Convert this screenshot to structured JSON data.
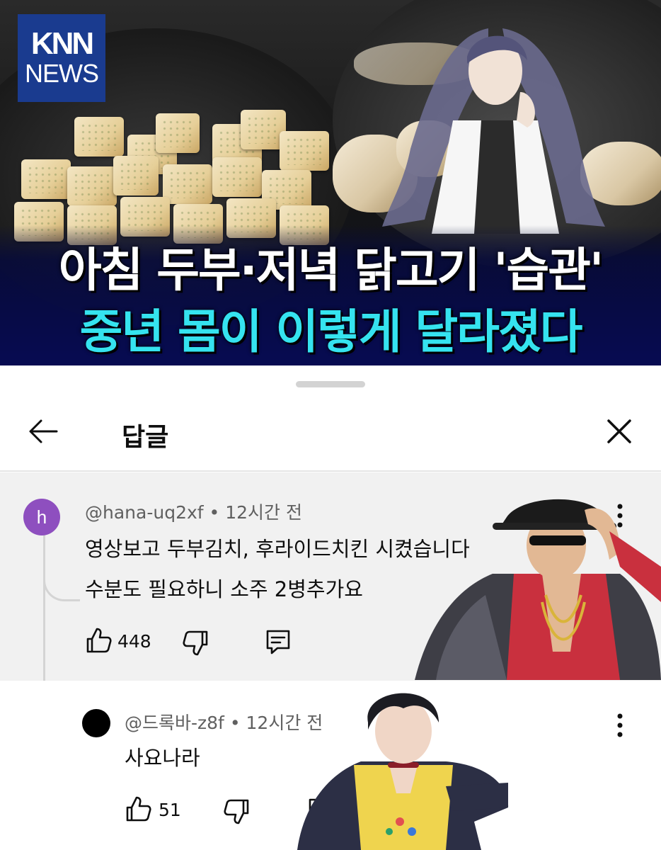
{
  "news": {
    "logo_top": "KNN",
    "logo_bottom": "NEWS",
    "headline_line1": "아침 두부·저녁 닭고기 '습관'",
    "headline_line2": "중년 몸이 이렇게 달라졌다"
  },
  "sheet": {
    "title": "답글"
  },
  "parent_comment": {
    "avatar_letter": "h",
    "author": "@hana-uq2xf",
    "separator": "•",
    "time": "12시간 전",
    "line1": "영상보고 두부김치, 후라이드치킨 시켰습니다",
    "line2": "수분도 필요하니 소주 2병추가요",
    "likes": "448"
  },
  "reply_comment": {
    "author": "@드록바-z8f",
    "separator": "•",
    "time": "12시간 전",
    "text": "사요나라",
    "likes": "51"
  },
  "colors": {
    "logo_bg": "#1a3b8f",
    "headline_cyan": "#35e3ef",
    "avatar_purple": "#8e4fbf",
    "comment_bg": "#f1f1f1"
  }
}
